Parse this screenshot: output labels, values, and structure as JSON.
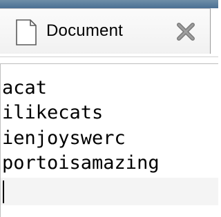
{
  "tab": {
    "label": "Document",
    "icon": "document-icon",
    "close_icon": "close-icon"
  },
  "editor": {
    "lines": [
      "acat",
      "ilikecats",
      "ienjoyswerc",
      "portoisamazing",
      ""
    ]
  },
  "colors": {
    "top_strip": "#4a6f93",
    "tab_background": "#f4f4f4",
    "text": "#000000"
  }
}
